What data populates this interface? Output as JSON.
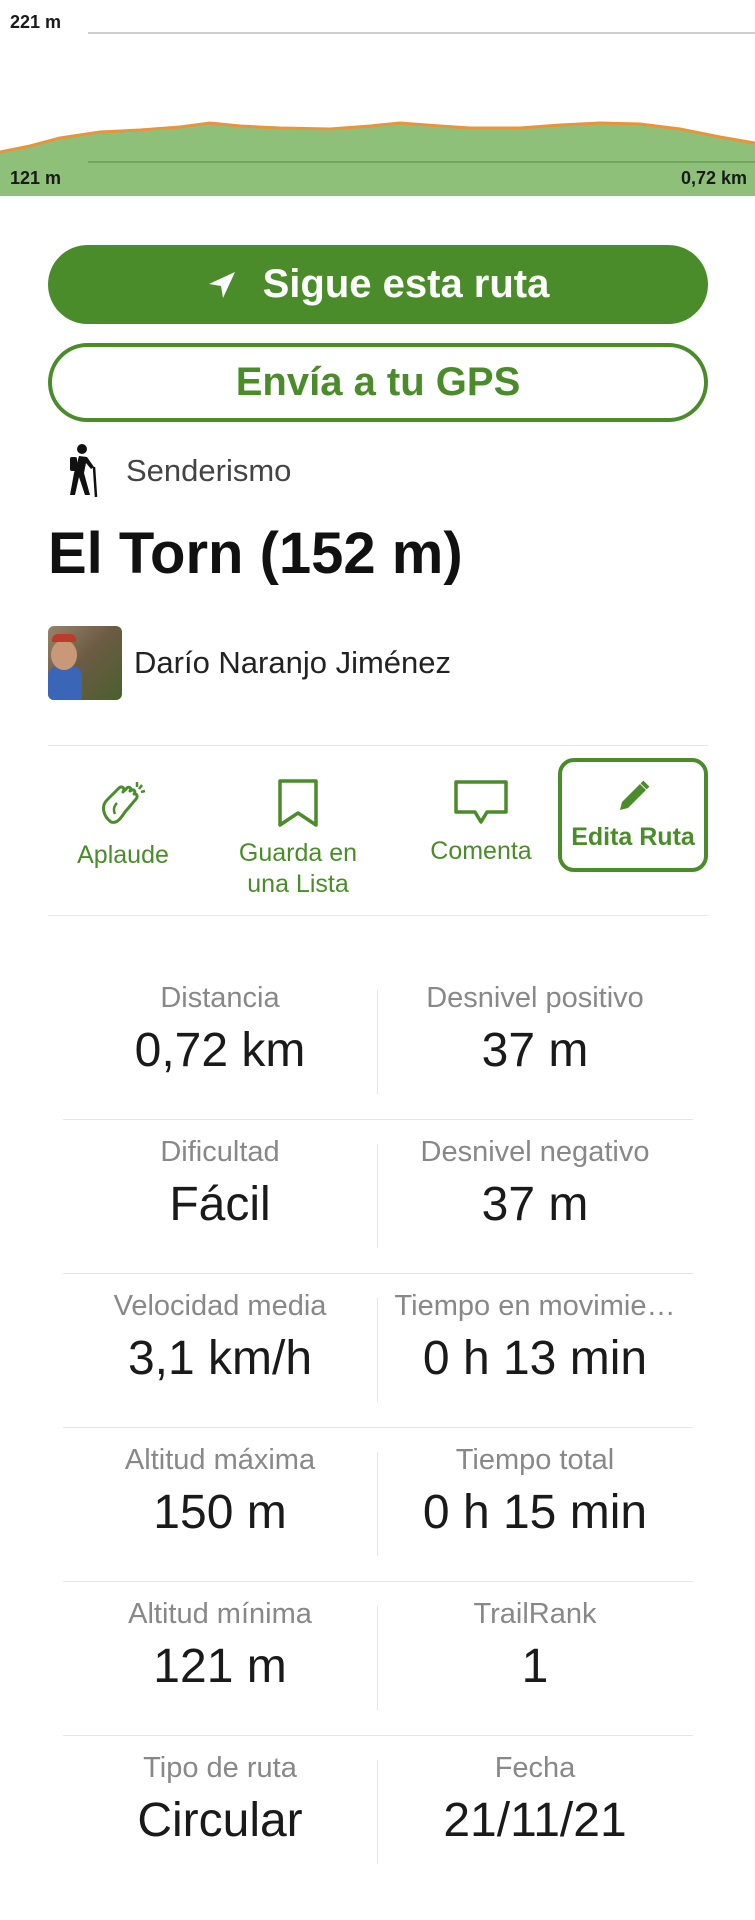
{
  "elevation_profile": {
    "max_label": "221 m",
    "min_label": "121 m",
    "distance_label": "0,72 km",
    "fill_color": "#8fc07a",
    "line_color": "#e8943a"
  },
  "buttons": {
    "follow_label": "Sigue esta ruta",
    "gps_label": "Envía a tu GPS"
  },
  "activity": {
    "type": "Senderismo",
    "icon": "hiker-icon"
  },
  "route": {
    "title": "El Torn (152 m)",
    "author": "Darío Naranjo Jiménez"
  },
  "actions": [
    {
      "label": "Aplaude",
      "icon": "clap-icon"
    },
    {
      "label": "Guarda en una Lista",
      "line1": "Guarda en",
      "line2": "una Lista",
      "icon": "bookmark-icon"
    },
    {
      "label": "Comenta",
      "icon": "comment-icon"
    },
    {
      "label": "Edita Ruta",
      "icon": "pencil-icon"
    }
  ],
  "stats": [
    [
      {
        "label": "Distancia",
        "value": "0,72 km"
      },
      {
        "label": "Desnivel positivo",
        "value": "37 m"
      }
    ],
    [
      {
        "label": "Dificultad",
        "value": "Fácil"
      },
      {
        "label": "Desnivel negativo",
        "value": "37 m"
      }
    ],
    [
      {
        "label": "Velocidad media",
        "value": "3,1 km/h"
      },
      {
        "label": "Tiempo en movimie…",
        "value": "0 h 13 min"
      }
    ],
    [
      {
        "label": "Altitud máxima",
        "value": "150 m"
      },
      {
        "label": "Tiempo total",
        "value": "0 h 15 min"
      }
    ],
    [
      {
        "label": "Altitud mínima",
        "value": "121 m"
      },
      {
        "label": "TrailRank",
        "value": "1"
      }
    ],
    [
      {
        "label": "Tipo de ruta",
        "value": "Circular"
      },
      {
        "label": "Fecha",
        "value": "21/11/21"
      }
    ]
  ],
  "colors": {
    "accent": "#4a8c2a"
  }
}
